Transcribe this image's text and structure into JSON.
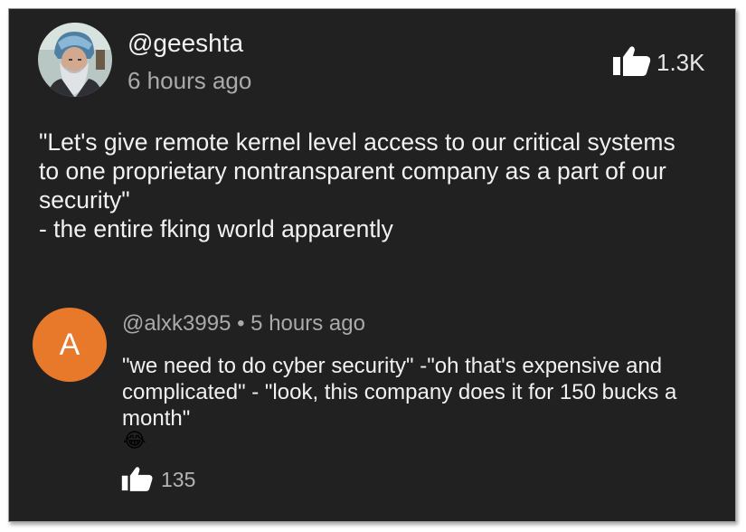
{
  "comment": {
    "author": "@geeshta",
    "time": "6 hours ago",
    "likes": "1.3K",
    "text": "\"Let's give remote kernel level access to our critical systems\nto one proprietary nontransparent company as a part of our\nsecurity\"\n- the entire fking world apparently",
    "avatar_icon": "bearded-man-portrait",
    "like_icon": "thumbs-up-icon"
  },
  "reply": {
    "avatar_letter": "A",
    "avatar_color": "#e8782a",
    "meta": "@alxk3995 • 5 hours ago",
    "text": "\"we need to do cyber security\" -\"oh that's expensive and\ncomplicated\" - \"look, this company does it for 150 bucks a\nmonth\"",
    "emoji": "😂",
    "likes": "135",
    "like_icon": "thumbs-up-icon"
  },
  "colors": {
    "background": "#212121",
    "primary_text": "#f1f1f1",
    "secondary_text": "#aaaaaa"
  }
}
